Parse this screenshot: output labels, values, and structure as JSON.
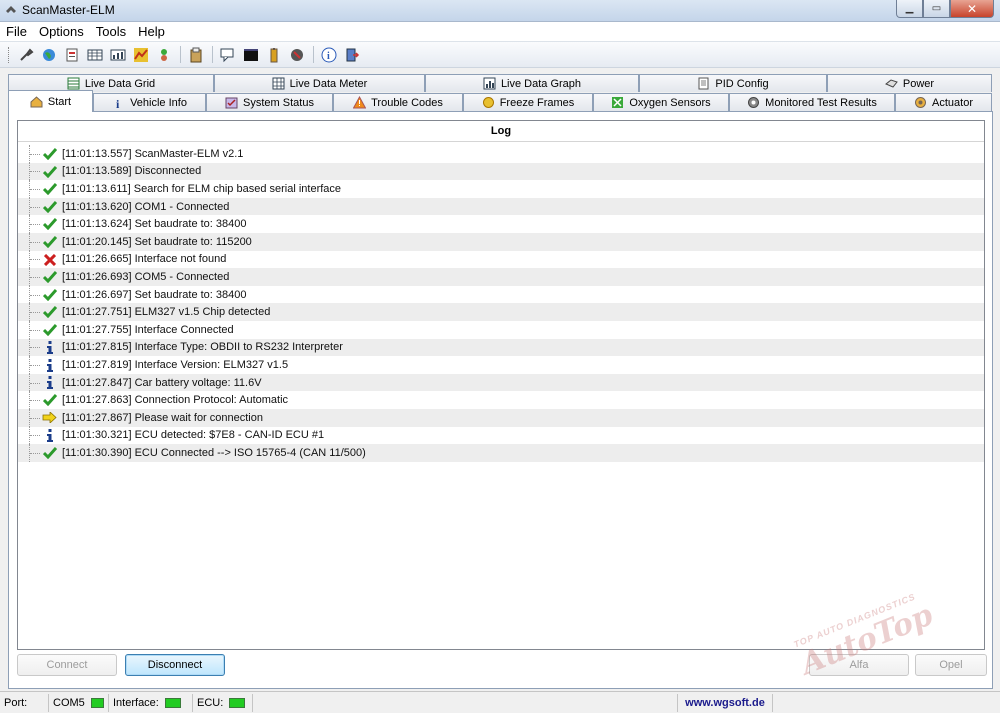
{
  "window": {
    "title": "ScanMaster-ELM"
  },
  "menu": {
    "items": [
      "File",
      "Options",
      "Tools",
      "Help"
    ]
  },
  "toolbar": {
    "icons": [
      "connect-icon",
      "globe-icon",
      "document-icon",
      "grid-icon",
      "meter-icon",
      "graph-icon",
      "wrench-icon",
      "clipboard-icon",
      "chat-icon",
      "terminal-icon",
      "battery-icon",
      "gauge-icon",
      "info-icon",
      "exit-icon"
    ]
  },
  "tabs_row1": [
    {
      "label": "Live Data Grid",
      "icon": "grid-icon"
    },
    {
      "label": "Live Data Meter",
      "icon": "meter-icon"
    },
    {
      "label": "Live Data Graph",
      "icon": "graph-icon"
    },
    {
      "label": "PID Config",
      "icon": "document-icon"
    },
    {
      "label": "Power",
      "icon": "power-icon"
    }
  ],
  "tabs_row2": [
    {
      "label": "Start",
      "icon": "home-icon",
      "active": true
    },
    {
      "label": "Vehicle Info",
      "icon": "info-icon"
    },
    {
      "label": "System Status",
      "icon": "status-icon"
    },
    {
      "label": "Trouble Codes",
      "icon": "warning-icon"
    },
    {
      "label": "Freeze Frames",
      "icon": "freeze-icon"
    },
    {
      "label": "Oxygen Sensors",
      "icon": "sensor-icon"
    },
    {
      "label": "Monitored Test Results",
      "icon": "gear-icon"
    },
    {
      "label": "Actuator",
      "icon": "actuator-icon"
    }
  ],
  "log": {
    "header": "Log",
    "entries": [
      {
        "type": "ok",
        "text": "[11:01:13.557] ScanMaster-ELM v2.1"
      },
      {
        "type": "ok",
        "text": "[11:01:13.589] Disconnected"
      },
      {
        "type": "ok",
        "text": "[11:01:13.611] Search for ELM chip based serial interface"
      },
      {
        "type": "ok",
        "text": "[11:01:13.620] COM1 - Connected"
      },
      {
        "type": "ok",
        "text": "[11:01:13.624] Set baudrate to: 38400"
      },
      {
        "type": "ok",
        "text": "[11:01:20.145] Set baudrate to: 115200"
      },
      {
        "type": "error",
        "text": "[11:01:26.665] Interface not found"
      },
      {
        "type": "ok",
        "text": "[11:01:26.693] COM5 - Connected"
      },
      {
        "type": "ok",
        "text": "[11:01:26.697] Set baudrate to: 38400"
      },
      {
        "type": "ok",
        "text": "[11:01:27.751] ELM327 v1.5 Chip detected"
      },
      {
        "type": "ok",
        "text": "[11:01:27.755] Interface Connected"
      },
      {
        "type": "info",
        "text": "[11:01:27.815] Interface Type: OBDII to RS232 Interpreter"
      },
      {
        "type": "info",
        "text": "[11:01:27.819] Interface Version: ELM327 v1.5"
      },
      {
        "type": "info",
        "text": "[11:01:27.847] Car battery voltage: 11.6V"
      },
      {
        "type": "ok",
        "text": "[11:01:27.863] Connection Protocol: Automatic"
      },
      {
        "type": "wait",
        "text": "[11:01:27.867] Please wait for connection"
      },
      {
        "type": "info",
        "text": "[11:01:30.321] ECU detected: $7E8 - CAN-ID ECU #1"
      },
      {
        "type": "ok",
        "text": "[11:01:30.390] ECU Connected --> ISO 15765-4 (CAN 11/500)"
      }
    ]
  },
  "buttons": {
    "connect": "Connect",
    "disconnect": "Disconnect",
    "alfa": "Alfa",
    "opel": "Opel"
  },
  "status": {
    "port_label": "Port:",
    "port_value": "COM5",
    "interface_label": "Interface:",
    "ecu_label": "ECU:",
    "website": "www.wgsoft.de",
    "led_color": "#22cc22"
  },
  "watermark": {
    "small": "TOP AUTO DIAGNOSTICS",
    "big": "AutoTop"
  }
}
